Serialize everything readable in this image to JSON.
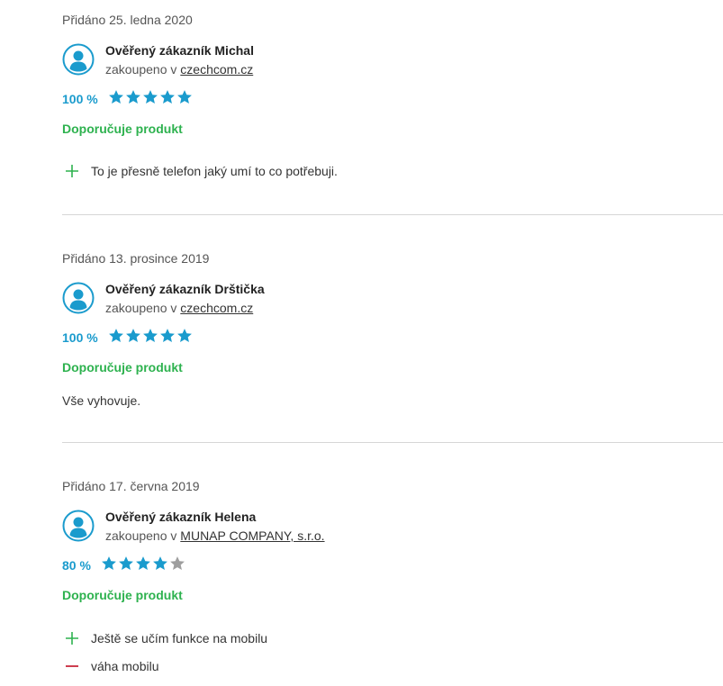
{
  "colors": {
    "accent_blue": "#1a9bcd",
    "recommend_green": "#2eb24f",
    "pro_green": "#2eb24f",
    "con_red": "#c8283c",
    "star_empty": "#9e9e9e"
  },
  "reviews": [
    {
      "date": "Přidáno 25. ledna 2020",
      "author": "Ověřený zákazník Michal",
      "purchased_prefix": "zakoupeno v",
      "shop": "czechcom.cz",
      "percent": "100 %",
      "rating": 5,
      "rating_max": 5,
      "recommend": "Doporučuje produkt",
      "pros": [
        "To je přesně telefon jaký umí to co potřebuji."
      ],
      "cons": [],
      "comment": ""
    },
    {
      "date": "Přidáno 13. prosince 2019",
      "author": "Ověřený zákazník Drštička",
      "purchased_prefix": "zakoupeno v",
      "shop": "czechcom.cz",
      "percent": "100 %",
      "rating": 5,
      "rating_max": 5,
      "recommend": "Doporučuje produkt",
      "pros": [],
      "cons": [],
      "comment": "Vše vyhovuje."
    },
    {
      "date": "Přidáno 17. června 2019",
      "author": "Ověřený zákazník Helena",
      "purchased_prefix": "zakoupeno v",
      "shop": "MUNAP COMPANY, s.r.o.",
      "percent": "80 %",
      "rating": 4,
      "rating_max": 5,
      "recommend": "Doporučuje produkt",
      "pros": [
        "Ještě se učím funkce na mobilu"
      ],
      "cons": [
        "váha mobilu"
      ],
      "comment": ""
    }
  ]
}
